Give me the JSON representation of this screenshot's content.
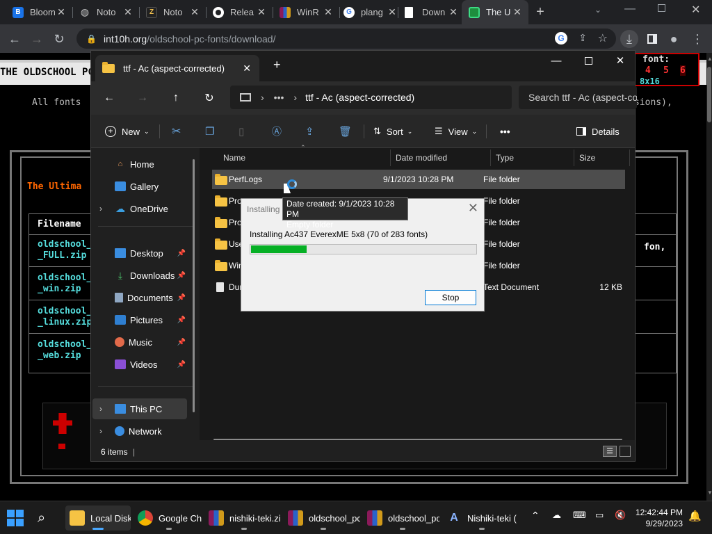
{
  "browser": {
    "tabs": [
      {
        "label": "Bloom",
        "favicon": "B"
      },
      {
        "label": "Noto",
        "favicon": "globe"
      },
      {
        "label": "Noto",
        "favicon": "Z"
      },
      {
        "label": "Relea",
        "favicon": "github"
      },
      {
        "label": "WinR",
        "favicon": "winrar"
      },
      {
        "label": "plang",
        "favicon": "G"
      },
      {
        "label": "Down",
        "favicon": "doc"
      },
      {
        "label": "The U",
        "favicon": "monitor",
        "active": true
      }
    ],
    "new_tab": "+",
    "url_host": "int10h.org",
    "url_path": "/oldschool-pc-fonts/download/"
  },
  "webpage": {
    "logo": "THE OLDSCHOOL PC",
    "font_label": "font:",
    "font_sizes": [
      "4",
      "5",
      "6"
    ],
    "font_dim": "8x16",
    "intro_text": "All fonts",
    "intro_tail": "sions),",
    "section_title": "The Ultima",
    "filename_header": "Filename",
    "files": [
      {
        "line1": "oldschool_",
        "line2": "_FULL.zip"
      },
      {
        "line1": "oldschool_",
        "line2": "_win.zip"
      },
      {
        "line1": "oldschool_",
        "line2": "_linux.zip"
      },
      {
        "line1": "oldschool_",
        "line2": "_web.zip"
      }
    ],
    "right_text": "fon,"
  },
  "explorer": {
    "tab_title": "ttf - Ac (aspect-corrected)",
    "address": "ttf - Ac (aspect-corrected)",
    "search_placeholder": "Search ttf - Ac (aspect-co",
    "commands": {
      "new": "New",
      "sort": "Sort",
      "view": "View",
      "details": "Details",
      "more": "•••"
    },
    "nav": [
      {
        "label": "Home",
        "icon": "home-icon"
      },
      {
        "label": "Gallery",
        "icon": "gallery-icon"
      },
      {
        "label": "OneDrive",
        "icon": "onedrive-icon"
      },
      {
        "label": "Desktop",
        "icon": "desktop-icon"
      },
      {
        "label": "Downloads",
        "icon": "downloads-icon"
      },
      {
        "label": "Documents",
        "icon": "documents-icon"
      },
      {
        "label": "Pictures",
        "icon": "pictures-icon"
      },
      {
        "label": "Music",
        "icon": "music-icon"
      },
      {
        "label": "Videos",
        "icon": "videos-icon"
      },
      {
        "label": "This PC",
        "icon": "this-pc-icon"
      },
      {
        "label": "Network",
        "icon": "network-icon"
      }
    ],
    "columns": {
      "name": "Name",
      "date": "Date modified",
      "type": "Type",
      "size": "Size"
    },
    "files": [
      {
        "name": "PerfLogs",
        "date": "9/1/2023 10:28 PM",
        "type": "File folder",
        "size": ""
      },
      {
        "name": "Pro",
        "date": "",
        "type": "File folder",
        "size": ""
      },
      {
        "name": "Pro",
        "date": "",
        "type": "File folder",
        "size": ""
      },
      {
        "name": "Use",
        "date": "",
        "type": "File folder",
        "size": ""
      },
      {
        "name": "Win",
        "date": "",
        "type": "File folder",
        "size": ""
      },
      {
        "name": "Dun",
        "date": "",
        "type": "Text Document",
        "size": "12 KB"
      }
    ],
    "status": "6 items"
  },
  "tooltip": {
    "line1": "Date created: 9/1/2023 10:28 PM",
    "line2": "Empty folder"
  },
  "dialog": {
    "title": "Installing",
    "message": "Installing Ac437 EverexME 5x8 (70 of 283 fonts)",
    "progress_fraction": 0.247,
    "stop_label": "Stop"
  },
  "taskbar": {
    "items": [
      {
        "label": "Local Disk",
        "icon": "file-explorer-icon"
      },
      {
        "label": "Google Ch",
        "icon": "chrome-icon"
      },
      {
        "label": "nishiki-teki.zip",
        "icon": "winrar-icon"
      },
      {
        "label": "oldschool_pc",
        "icon": "winrar-icon"
      },
      {
        "label": "oldschool_pc",
        "icon": "winrar-icon"
      },
      {
        "label": "Nishiki-teki (",
        "icon": "font-icon"
      }
    ],
    "time": "12:42:44 PM",
    "date": "9/29/2023"
  },
  "colors": {
    "explorer_bg": "#202020",
    "progress_green": "#06b025",
    "web_accent": "#ff6600",
    "web_link": "#55dddd",
    "accent_blue": "#0078d4"
  }
}
